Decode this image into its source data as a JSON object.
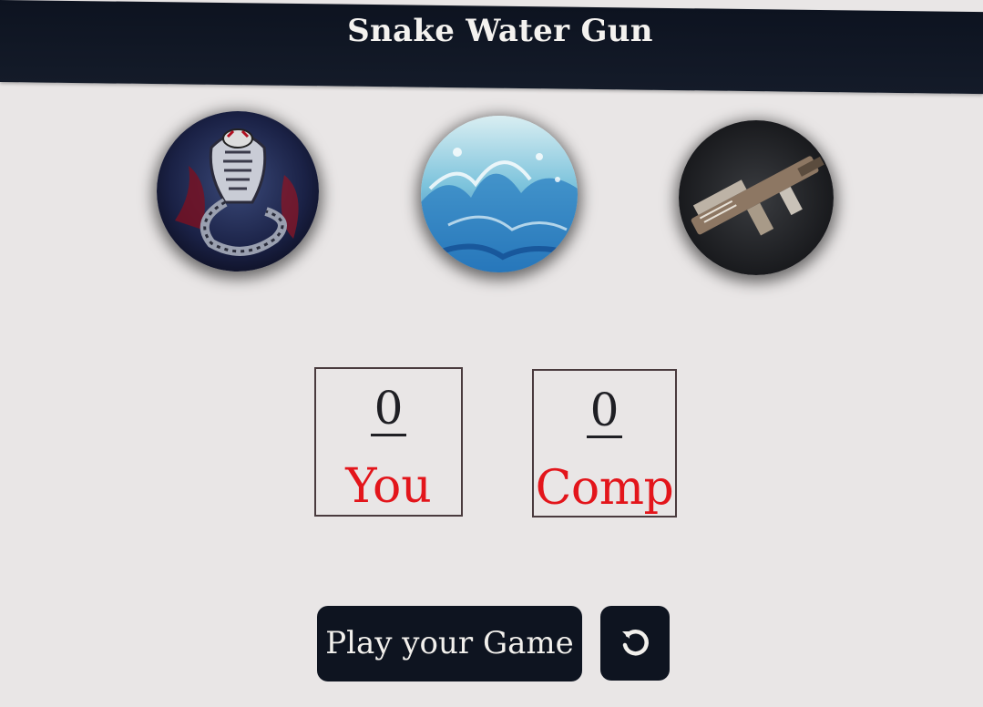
{
  "app": {
    "title": "Snake Water Gun"
  },
  "choices": [
    {
      "name": "snake",
      "icon": "cobra-image"
    },
    {
      "name": "water",
      "icon": "water-splash-image"
    },
    {
      "name": "gun",
      "icon": "rifle-image"
    }
  ],
  "scores": {
    "user": {
      "value": "0",
      "label": "You"
    },
    "computer": {
      "value": "0",
      "label": "Comp"
    }
  },
  "actions": {
    "play_label": "Play your Game",
    "reset_icon": "reset-icon"
  },
  "colors": {
    "header_bg": "#0e1420",
    "page_bg": "#e9e6e6",
    "score_label": "#e3151b",
    "button_bg": "#0e1420",
    "button_text": "#f2f0ec"
  }
}
